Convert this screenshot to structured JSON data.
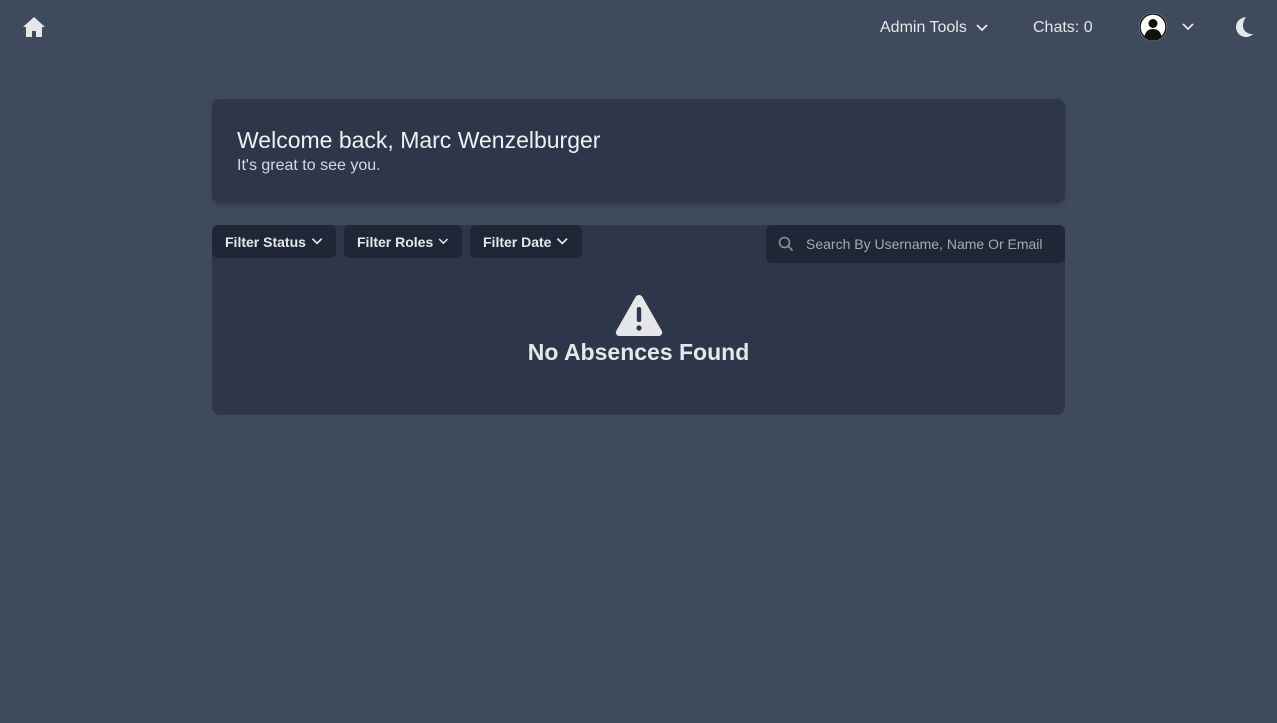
{
  "topbar": {
    "home_icon": "home-icon",
    "admin_tools_label": "Admin Tools",
    "chats_label": "Chats: 0",
    "avatar_icon": "user-avatar-icon",
    "theme_icon": "moon-icon"
  },
  "welcome": {
    "title": "Welcome back, Marc Wenzelburger",
    "subtitle": "It's great to see you."
  },
  "filters": {
    "status_label": "Filter Status",
    "roles_label": "Filter Roles",
    "date_label": "Filter Date"
  },
  "search": {
    "placeholder": "Search By Username, Name Or Email",
    "value": ""
  },
  "empty_state": {
    "icon": "warning-icon",
    "message": "No Absences Found"
  },
  "colors": {
    "page_bg": "#3f4b5c",
    "card_bg": "#2e3749",
    "control_bg": "#1f2737",
    "text": "#e5e7eb"
  }
}
